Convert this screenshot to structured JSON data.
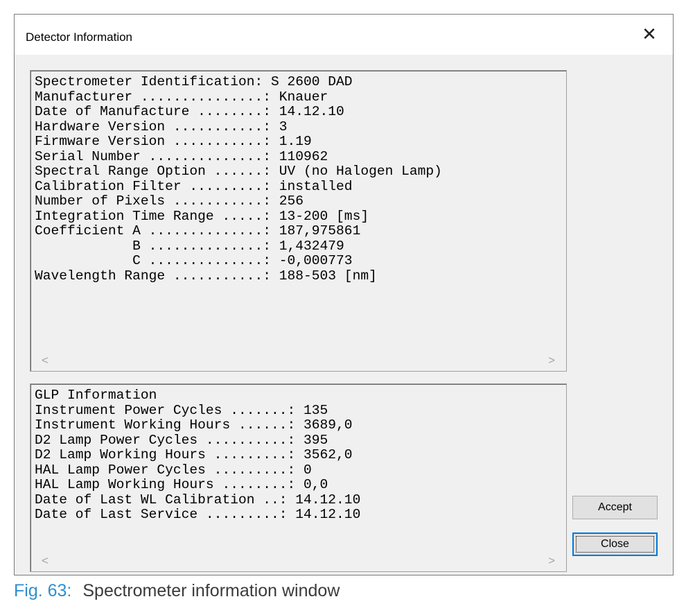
{
  "window": {
    "title": "Detector Information",
    "close_glyph": "✕"
  },
  "spectrometer_panel": {
    "lines": [
      "Spectrometer Identification: S 2600 DAD",
      "Manufacturer ...............: Knauer",
      "Date of Manufacture ........: 14.12.10",
      "Hardware Version ...........: 3",
      "Firmware Version ...........: 1.19",
      "Serial Number ..............: 110962",
      "Spectral Range Option ......: UV (no Halogen Lamp)",
      "Calibration Filter .........: installed",
      "Number of Pixels ...........: 256",
      "Integration Time Range .....: 13-200 [ms]",
      "Coefficient A ..............: 187,975861",
      "            B ..............: 1,432479",
      "            C ..............: -0,000773",
      "Wavelength Range ...........: 188-503 [nm]"
    ]
  },
  "glp_panel": {
    "lines": [
      "GLP Information",
      "Instrument Power Cycles .......: 135",
      "Instrument Working Hours ......: 3689,0",
      "D2 Lamp Power Cycles ..........: 395",
      "D2 Lamp Working Hours .........: 3562,0",
      "HAL Lamp Power Cycles .........: 0",
      "HAL Lamp Working Hours ........: 0,0",
      "Date of Last WL Calibration ..: 14.12.10",
      "Date of Last Service .........: 14.12.10"
    ]
  },
  "scrollbar": {
    "left_arrow": "<",
    "right_arrow": ">"
  },
  "buttons": {
    "accept": "Accept",
    "close": "Close"
  },
  "caption": {
    "figure_number": "Fig. 63:",
    "text": "Spectrometer information window"
  },
  "colors": {
    "caption_accent": "#2f8fd0",
    "focus_border": "#0078d7"
  }
}
